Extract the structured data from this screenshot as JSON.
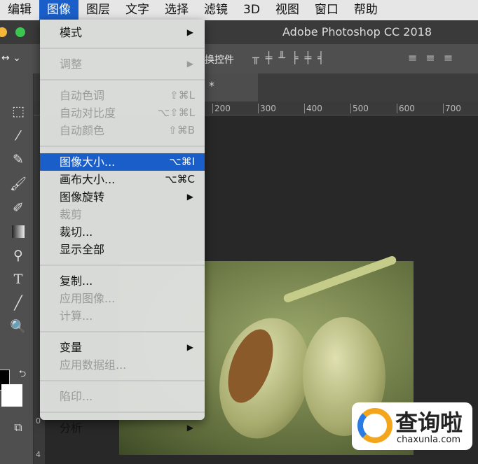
{
  "menubar": {
    "items": [
      "编辑",
      "图像",
      "图层",
      "文字",
      "选择",
      "滤镜",
      "3D",
      "视图",
      "窗口",
      "帮助"
    ]
  },
  "window": {
    "title": "Adobe Photoshop CC 2018"
  },
  "options": {
    "transform_label": "换控件"
  },
  "tab": {
    "label": "*"
  },
  "ruler": {
    "ticks": [
      "200",
      "300",
      "400",
      "500",
      "600",
      "700"
    ],
    "vticks": [
      "0",
      "4"
    ]
  },
  "menu": {
    "mode": "模式",
    "adjust": "调整",
    "auto_tone": "自动色调",
    "auto_tone_sc": "⇧⌘L",
    "auto_contrast": "自动对比度",
    "auto_contrast_sc": "⌥⇧⌘L",
    "auto_color": "自动颜色",
    "auto_color_sc": "⇧⌘B",
    "image_size": "图像大小...",
    "image_size_sc": "⌥⌘I",
    "canvas_size": "画布大小...",
    "canvas_size_sc": "⌥⌘C",
    "rotation": "图像旋转",
    "crop": "裁剪",
    "trim": "裁切...",
    "reveal_all": "显示全部",
    "duplicate": "复制...",
    "apply_image": "应用图像...",
    "calculations": "计算...",
    "variables": "变量",
    "apply_data_set": "应用数据组...",
    "trap": "陷印...",
    "analysis": "分析",
    "arrow": "▶"
  },
  "watermark": {
    "name": "查询啦",
    "url": "chaxunla.com"
  }
}
